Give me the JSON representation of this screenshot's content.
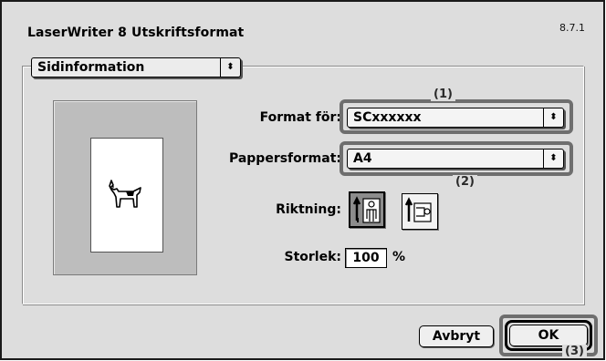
{
  "dialog": {
    "title": "LaserWriter 8 Utskriftsformat",
    "version": "8.7.1"
  },
  "section_popup": {
    "value": "Sidinformation",
    "arrows": "⬍"
  },
  "preview": {
    "icon": "dogcow-icon"
  },
  "format_for": {
    "label": "Format för:",
    "value": "SCxxxxxx",
    "arrows": "⬍"
  },
  "paper_format": {
    "label": "Pappersformat:",
    "value": "A4",
    "arrows": "⬍"
  },
  "orientation": {
    "label": "Riktning:",
    "options": [
      "portrait-icon",
      "landscape-icon"
    ],
    "selected": "portrait-icon"
  },
  "size": {
    "label": "Storlek:",
    "value": "100",
    "unit": "%"
  },
  "buttons": {
    "cancel": "Avbryt",
    "ok": "OK"
  },
  "callouts": {
    "one": "(1)",
    "two": "(2)",
    "three": "(3)"
  },
  "colors": {
    "dialog_bg": "#dddddd",
    "highlight": "#6e6e6e"
  }
}
